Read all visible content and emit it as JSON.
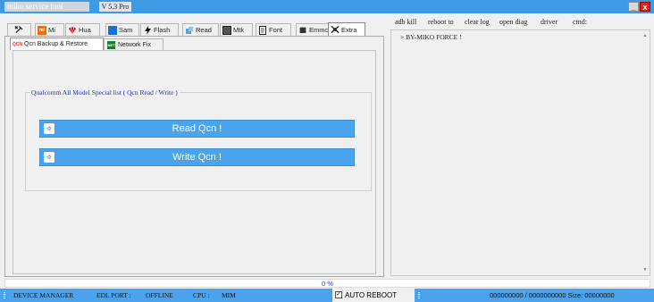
{
  "titlebar": {
    "app_title": "miko service tool",
    "version": "V 5.3 Pro",
    "minimize_label": "_",
    "close_label": "x"
  },
  "tabs": [
    {
      "label": "",
      "icon": "tools-icon"
    },
    {
      "label": "Mi",
      "icon": "mi-logo-icon"
    },
    {
      "label": "Hua",
      "icon": "huawei-logo-icon"
    },
    {
      "label": "Sam",
      "icon": "samsung-icon"
    },
    {
      "label": "Flash",
      "icon": "lightning-icon"
    },
    {
      "label": "Read",
      "icon": "read-icon"
    },
    {
      "label": "Mtk",
      "icon": "chip-icon"
    },
    {
      "label": "Font",
      "icon": "document-icon"
    },
    {
      "label": "Emmc",
      "icon": "emmc-chip-icon"
    },
    {
      "label": "Extra",
      "icon": "extra-tools-icon"
    }
  ],
  "subtabs": [
    {
      "label": "Qcn Backup & Restore",
      "icon": "qcn-icon"
    },
    {
      "label": "Network Fix",
      "icon": "network-fix-icon"
    }
  ],
  "qcn_group": {
    "title": "Qualcomm All Model Special list ( Qcn Read / Write )",
    "read_button": "Read Qcn !",
    "write_button": "Write Qcn !"
  },
  "right_toolbar": {
    "adb_kill": "adb kill",
    "reboot_to": "reboot to",
    "clear_log": "clear log",
    "open_diag": "open diag",
    "driver": "driver",
    "cmd": "cmd:"
  },
  "console": {
    "line1": "> BY-MIKO FORCE !"
  },
  "progress": {
    "value": 0,
    "text": "0 %"
  },
  "statusbar": {
    "device_manager": "DEVICE MANAGER",
    "edl_port_label": "EDL PORT :",
    "edl_port_value": "OFFLINE",
    "cpu_label": "CPU :",
    "cpu_value": "MIM",
    "auto_reboot_label": "AUTO REBOOT",
    "auto_reboot_checked": true,
    "size_info": "000000000 / 0000000000 Size: 00000000"
  },
  "colors": {
    "accent": "#4aa3ec",
    "titlebar": "#3f9ae6",
    "close": "#e0241b",
    "group_title": "#1e2fd0"
  }
}
